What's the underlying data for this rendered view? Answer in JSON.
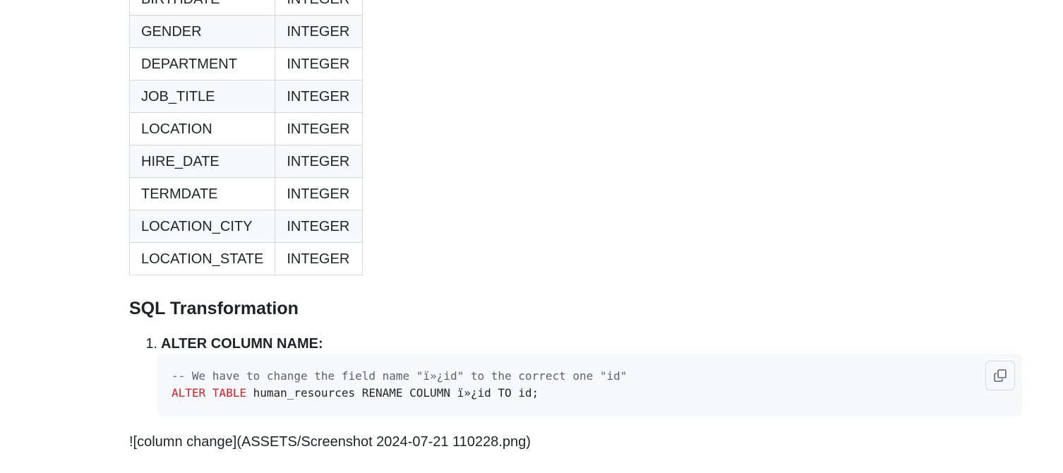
{
  "schema_table": {
    "rows": [
      {
        "name": "BIRTHDATE",
        "type": "INTEGER"
      },
      {
        "name": "GENDER",
        "type": "INTEGER"
      },
      {
        "name": "DEPARTMENT",
        "type": "INTEGER"
      },
      {
        "name": "JOB_TITLE",
        "type": "INTEGER"
      },
      {
        "name": "LOCATION",
        "type": "INTEGER"
      },
      {
        "name": "HIRE_DATE",
        "type": "INTEGER"
      },
      {
        "name": "TERMDATE",
        "type": "INTEGER"
      },
      {
        "name": "LOCATION_CITY",
        "type": "INTEGER"
      },
      {
        "name": "LOCATION_STATE",
        "type": "INTEGER"
      }
    ]
  },
  "section": {
    "heading": "SQL Transformation"
  },
  "steps": [
    {
      "number": "1.",
      "title": "ALTER COLUMN NAME:"
    }
  ],
  "code": {
    "comment": "-- We have to change the field name \"ï»¿id\" to the correct one \"id\"",
    "keyword": "ALTER TABLE",
    "statement_rest": " human_resources RENAME COLUMN ï»¿id TO id;"
  },
  "copy_button": {
    "icon": "copy-icon"
  },
  "image_markdown": "![column change](ASSETS/Screenshot 2024-07-21 110228.png)",
  "colors": {
    "keyword": "#cf222e",
    "comment": "#59636e",
    "code_background": "#f6f8fa",
    "border": "#d1d9e0"
  }
}
